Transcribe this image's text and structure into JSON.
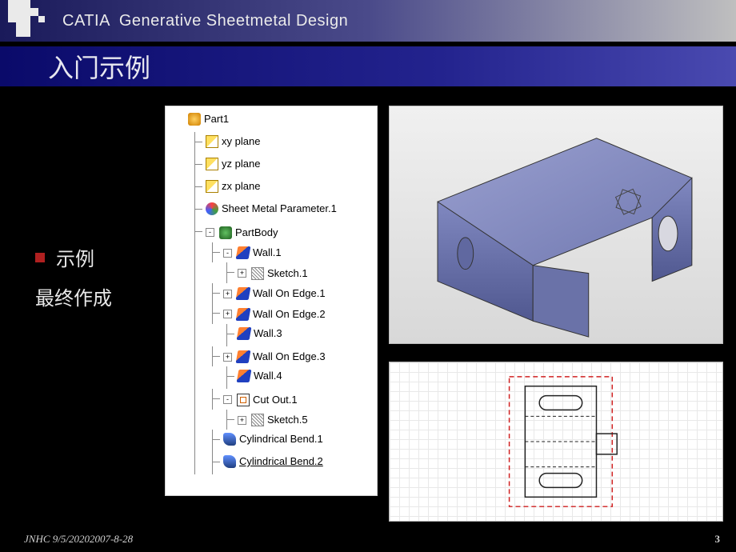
{
  "header": {
    "brand": "CATIA",
    "subtitle": "Generative Sheetmetal Design"
  },
  "slide_title": "入门示例",
  "body": {
    "bullet1": "示例",
    "line2": "最终作成"
  },
  "tree": {
    "root": "Part1",
    "planes": [
      "xy plane",
      "yz plane",
      "zx plane"
    ],
    "param": "Sheet Metal Parameter.1",
    "body_label": "PartBody",
    "features": [
      {
        "name": "Wall.1",
        "icon": "wall",
        "exp": "-"
      },
      {
        "name": "Sketch.1",
        "icon": "sketch",
        "indent": 1,
        "exp": "+"
      },
      {
        "name": "Wall On Edge.1",
        "icon": "wall",
        "exp": "+"
      },
      {
        "name": "Wall On Edge.2",
        "icon": "wall",
        "exp": "+"
      },
      {
        "name": "Wall.3",
        "icon": "wall",
        "indent": 1
      },
      {
        "name": "Wall On Edge.3",
        "icon": "wall",
        "exp": "+"
      },
      {
        "name": "Wall.4",
        "icon": "wall",
        "indent": 1
      },
      {
        "name": "Cut Out.1",
        "icon": "cut",
        "exp": "-"
      },
      {
        "name": "Sketch.5",
        "icon": "sketch",
        "indent": 1,
        "exp": "+"
      },
      {
        "name": "Cylindrical Bend.1",
        "icon": "bend"
      },
      {
        "name": "Cylindrical Bend.2",
        "icon": "bend",
        "underline": true
      }
    ]
  },
  "footer": {
    "left": "JNHC 9/5/20202007-8-28",
    "page": "3"
  }
}
